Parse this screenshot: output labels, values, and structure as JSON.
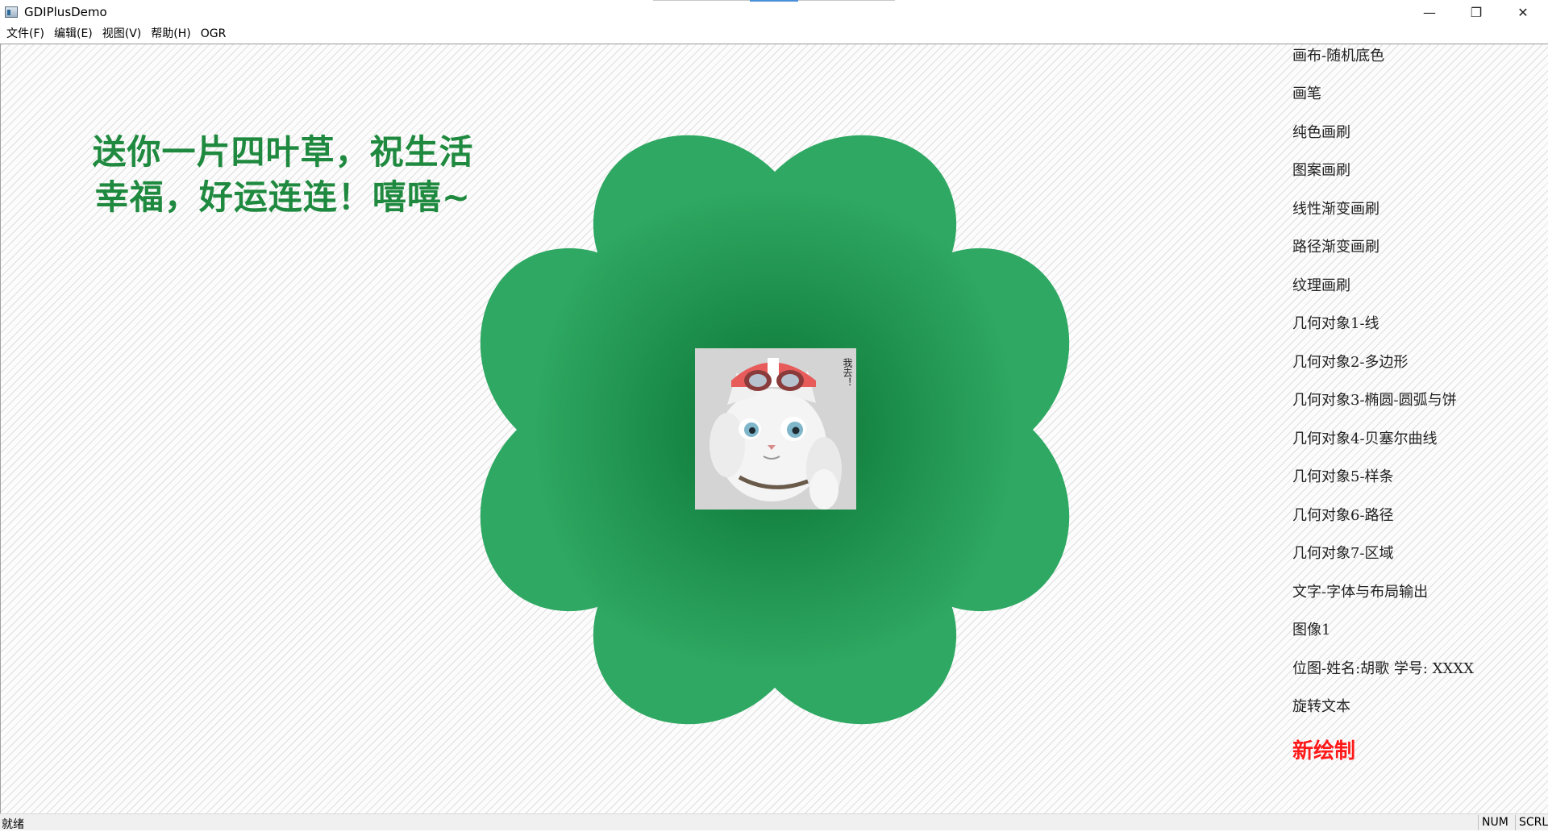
{
  "window": {
    "title": "GDIPlusDemo",
    "minimize_glyph": "—",
    "maximize_glyph": "❐",
    "close_glyph": "✕"
  },
  "menubar": {
    "items": [
      "文件(F)",
      "编辑(E)",
      "视图(V)",
      "帮助(H)",
      "OGR"
    ]
  },
  "canvas": {
    "greeting_line1": "送你一片四叶草，祝生活",
    "greeting_line2": "幸福，好运连连！嘻嘻~",
    "clover_color": "#2a9d5c",
    "clover_center_color": "#0f7a3a",
    "cat_caption": "我去！"
  },
  "right_menu": {
    "items": [
      "画布-随机底色",
      "画笔",
      "纯色画刷",
      "图案画刷",
      "线性渐变画刷",
      "路径渐变画刷",
      "纹理画刷",
      "几何对象1-线",
      "几何对象2-多边形",
      "几何对象3-椭圆-圆弧与饼",
      "几何对象4-贝塞尔曲线",
      "几何对象5-样条",
      "几何对象6-路径",
      "几何对象7-区域",
      "文字-字体与布局输出",
      "图像1",
      "位图-姓名:胡歌  学号: XXXX",
      "旋转文本"
    ],
    "new_draw": "新绘制",
    "new_draw_color": "#ff1a1a"
  },
  "statusbar": {
    "ready": "就绪",
    "num": "NUM",
    "scrl": "SCRL"
  }
}
